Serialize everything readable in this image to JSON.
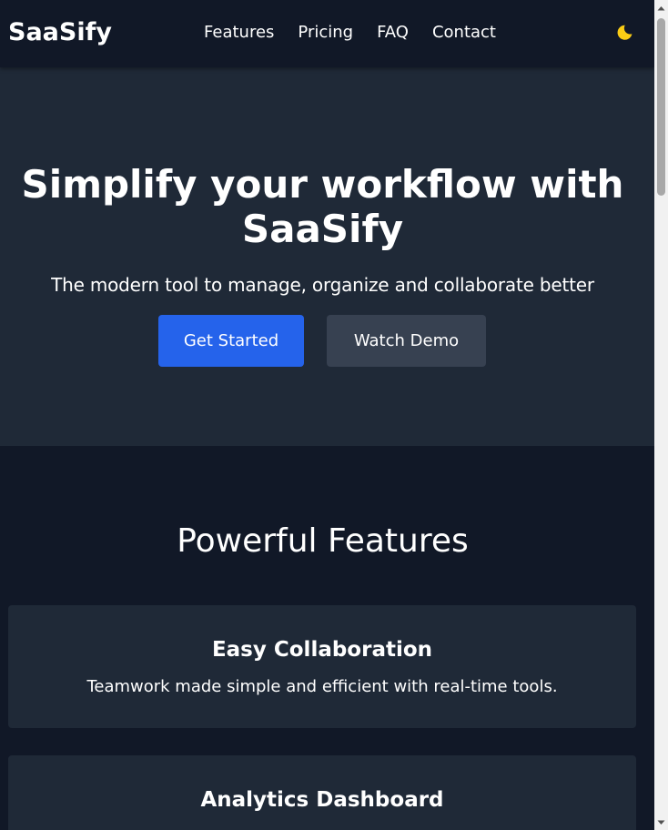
{
  "navbar": {
    "brand": "SaaSify",
    "links": [
      {
        "label": "Features"
      },
      {
        "label": "Pricing"
      },
      {
        "label": "FAQ"
      },
      {
        "label": "Contact"
      }
    ],
    "theme_toggle_icon": "moon-icon"
  },
  "hero": {
    "title": "Simplify your workflow with SaaSify",
    "subtitle": "The modern tool to manage, organize and collaborate better",
    "primary_button": "Get Started",
    "secondary_button": "Watch Demo"
  },
  "features": {
    "title": "Powerful Features",
    "cards": [
      {
        "title": "Easy Collaboration",
        "description": "Teamwork made simple and efficient with real-time tools."
      },
      {
        "title": "Analytics Dashboard",
        "description": ""
      }
    ]
  },
  "colors": {
    "page_bg": "#111827",
    "section_bg": "#1f2937",
    "primary": "#2563eb",
    "secondary": "#374151",
    "moon": "#facc15"
  }
}
